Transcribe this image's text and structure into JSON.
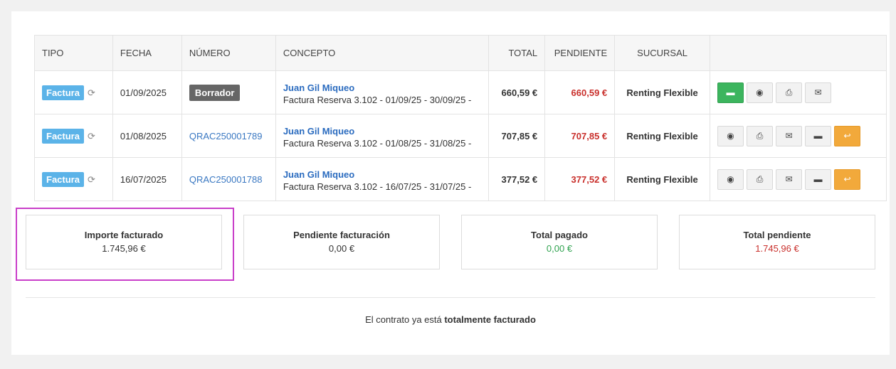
{
  "table": {
    "headers": [
      "TIPO",
      "FECHA",
      "NÚMERO",
      "CONCEPTO",
      "TOTAL",
      "PENDIENTE",
      "SUCURSAL",
      ""
    ],
    "rows": [
      {
        "tipo": "Factura",
        "fecha": "01/09/2025",
        "numero": "Borrador",
        "numero_is_draft": true,
        "cliente": "Juan Gil Miqueo",
        "concepto": "Factura Reserva 3.102 - 01/09/25 - 30/09/25 -",
        "total": "660,59 €",
        "pendiente": "660,59 €",
        "sucursal": "Renting Flexible"
      },
      {
        "tipo": "Factura",
        "fecha": "01/08/2025",
        "numero": "QRAC250001789",
        "numero_is_draft": false,
        "cliente": "Juan Gil Miqueo",
        "concepto": "Factura Reserva 3.102 - 01/08/25 - 31/08/25 -",
        "total": "707,85 €",
        "pendiente": "707,85 €",
        "sucursal": "Renting Flexible"
      },
      {
        "tipo": "Factura",
        "fecha": "16/07/2025",
        "numero": "QRAC250001788",
        "numero_is_draft": false,
        "cliente": "Juan Gil Miqueo",
        "concepto": "Factura Reserva 3.102 - 16/07/25 - 31/07/25 -",
        "total": "377,52 €",
        "pendiente": "377,52 €",
        "sucursal": "Renting Flexible"
      }
    ]
  },
  "summary": [
    {
      "title": "Importe facturado",
      "value": "1.745,96 €",
      "color": "#333333"
    },
    {
      "title": "Pendiente facturación",
      "value": "0,00 €",
      "color": "#333333"
    },
    {
      "title": "Total pagado",
      "value": "0,00 €",
      "color": "#2fa24f"
    },
    {
      "title": "Total pendiente",
      "value": "1.745,96 €",
      "color": "#c9302c"
    }
  ],
  "footer": {
    "prefix": "El contrato ya está ",
    "strong": "totalmente facturado"
  },
  "colors": {
    "badge": "#5bb3e8",
    "link": "#2a6bbf",
    "pending": "#c9302c",
    "pay_button": "#3cb55e",
    "refund_button": "#f2a93b",
    "highlight": "#c93fc9"
  }
}
